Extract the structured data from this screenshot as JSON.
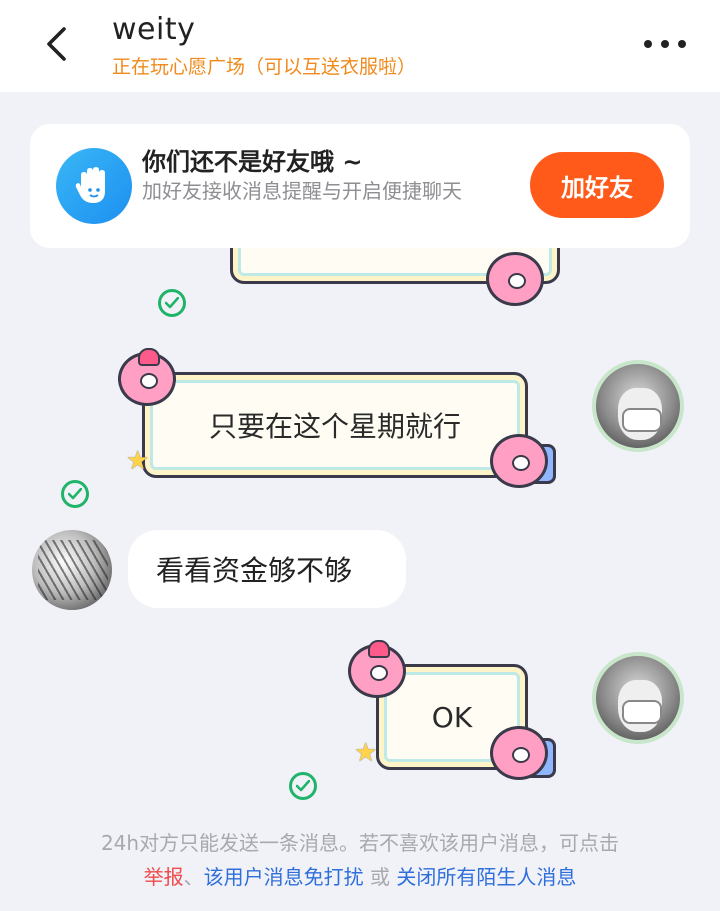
{
  "header": {
    "title": "weity",
    "subtitle": "正在玩心愿广场（可以互送衣服啦）"
  },
  "friend_card": {
    "title": "你们还不是好友哦 ~",
    "description": "加好友接收消息提醒与开启便捷聊天",
    "button_label": "加好友"
  },
  "messages": [
    {
      "side": "right",
      "style": "sticker-bubble",
      "text": "只要在这个星期就行",
      "status": "sent-check"
    },
    {
      "side": "left",
      "style": "plain",
      "text": "看看资金够不够"
    },
    {
      "side": "right",
      "style": "sticker-bubble",
      "text": "OK",
      "status": "sent-check"
    }
  ],
  "footer": {
    "notice": "24h对方只能发送一条消息。若不喜欢该用户消息，可点击",
    "report_label": "举报",
    "sep1": "、",
    "mute_label": "该用户消息免打扰",
    "sep2": " 或 ",
    "close_strangers_label": "关闭所有陌生人消息"
  },
  "colors": {
    "accent_orange": "#ff5a1a",
    "subtitle_orange": "#f08a1c",
    "check_green": "#20b46a",
    "link_blue": "#2f6fdc",
    "link_red": "#ef4b4b"
  },
  "icons": {
    "back": "chevron-left-icon",
    "more": "more-dots-icon",
    "friend_card": "hand-wave-icon",
    "sent": "check-circle-icon"
  }
}
